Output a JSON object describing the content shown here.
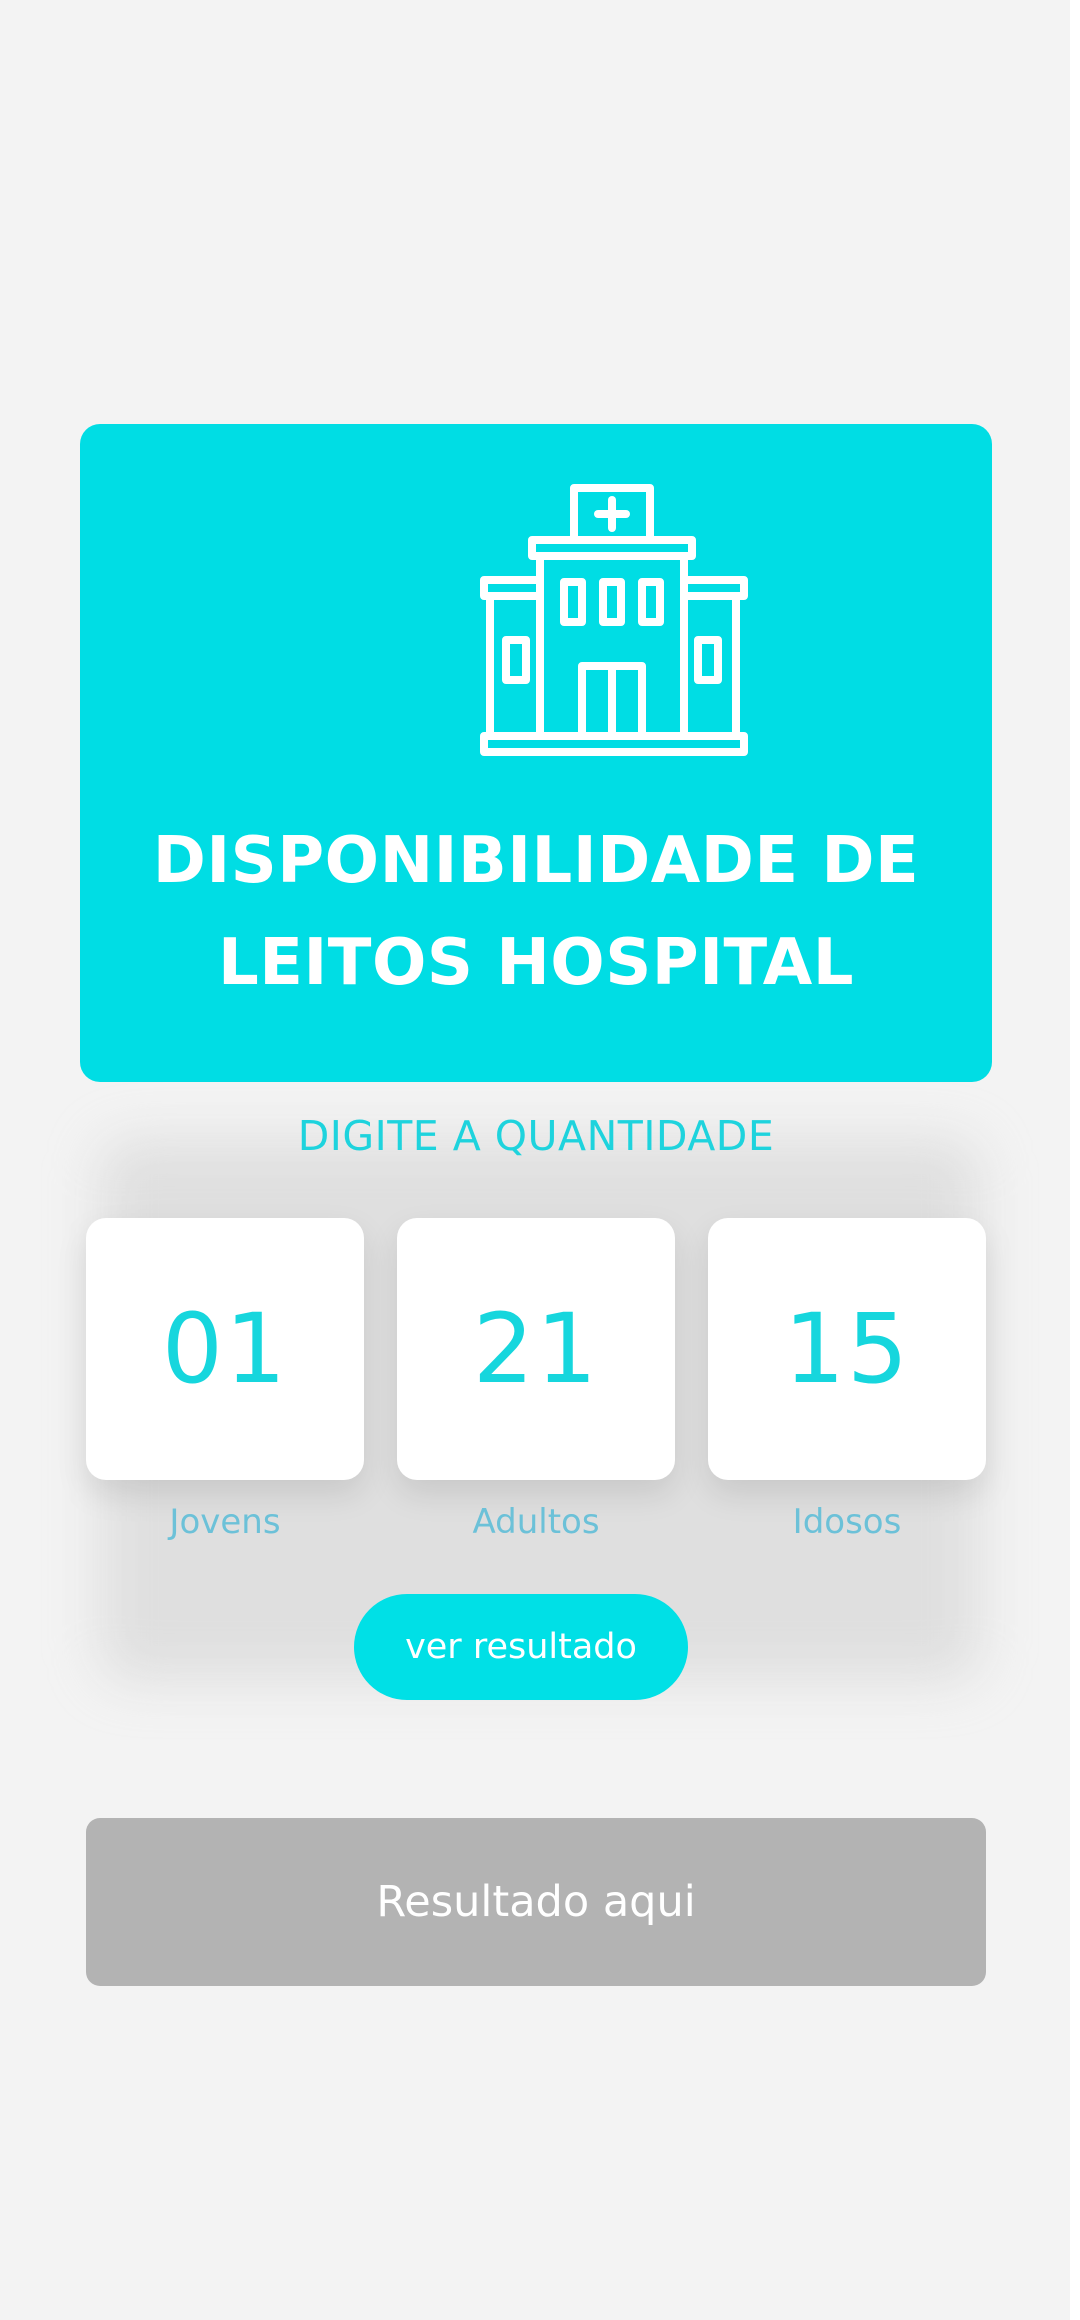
{
  "app": {
    "title_line_1": "DISPONIBILIDADE DE",
    "title_line_2": "LEITOS HOSPITAL",
    "icon": "hospital-building-icon"
  },
  "form": {
    "prompt": "DIGITE A QUANTIDADE",
    "counters": [
      {
        "value": "01",
        "label": "Jovens"
      },
      {
        "value": "21",
        "label": "Adultos"
      },
      {
        "value": "15",
        "label": "Idosos"
      }
    ],
    "submit_label": "ver resultado"
  },
  "result": {
    "placeholder": "Resultado aqui"
  },
  "colors": {
    "accent": "#00DDE4",
    "background": "#F3F3F3",
    "result_box": "#B3B3B3",
    "label": "#6CC1D8"
  }
}
